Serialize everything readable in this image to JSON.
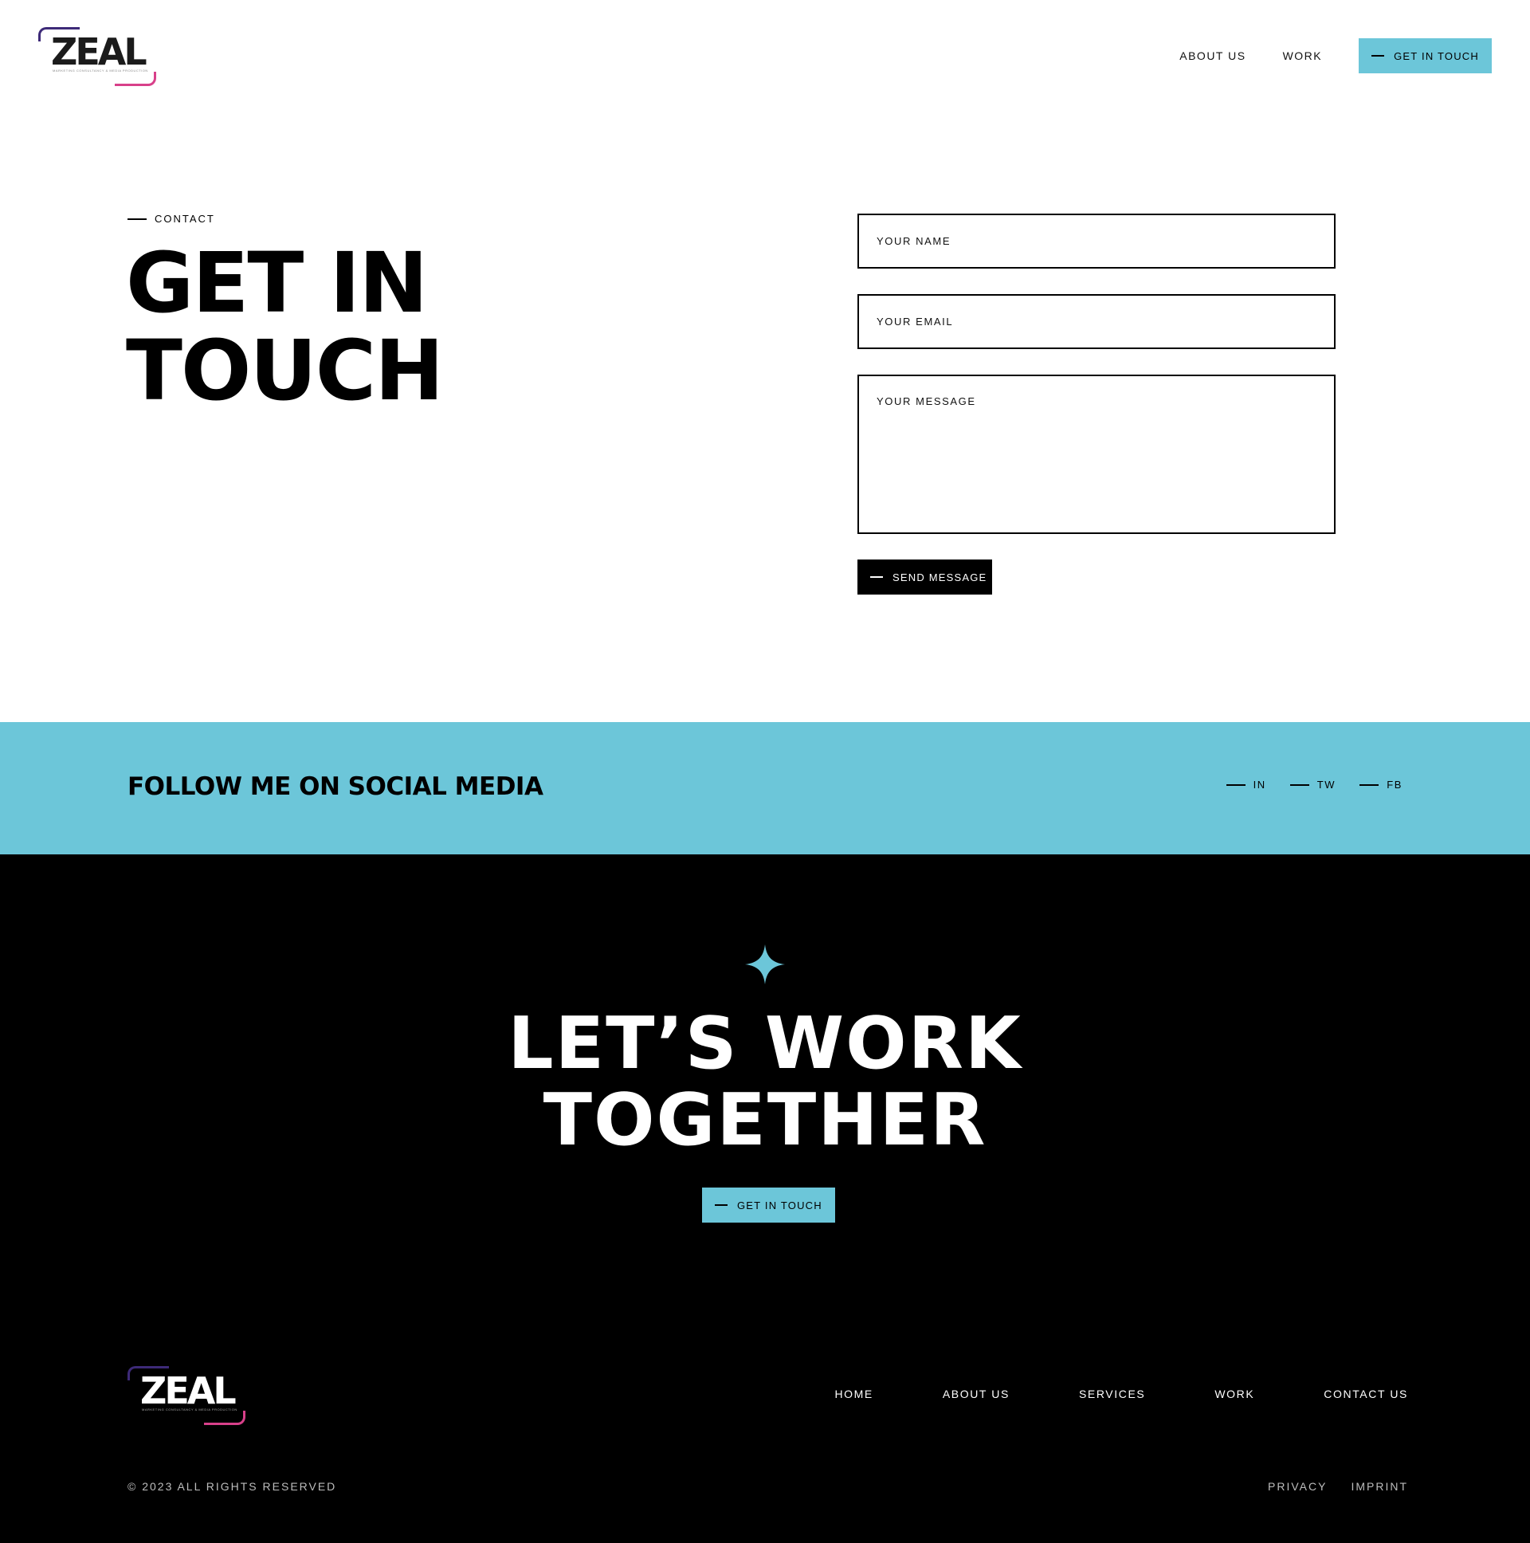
{
  "brand": {
    "name": "ZEAL",
    "tagline": "MARKETING CONSULTANCY & MEDIA PRODUCTION"
  },
  "header": {
    "nav": [
      {
        "label": "ABOUT US"
      },
      {
        "label": "WORK"
      }
    ],
    "cta_label": "GET IN TOUCH"
  },
  "contact": {
    "eyebrow": "CONTACT",
    "title_line1": "GET IN",
    "title_line2": "TOUCH",
    "name_placeholder": "YOUR NAME",
    "email_placeholder": "YOUR EMAIL",
    "message_placeholder": "YOUR MESSAGE",
    "submit_label": "SEND MESSAGE"
  },
  "social": {
    "title": "FOLLOW ME ON SOCIAL MEDIA",
    "links": [
      {
        "label": "IN"
      },
      {
        "label": "TW"
      },
      {
        "label": "FB"
      }
    ]
  },
  "cta": {
    "icon": "sparkle-icon",
    "title_line1": "LET’S WORK",
    "title_line2": "TOGETHER",
    "button_label": "GET IN TOUCH"
  },
  "footer": {
    "nav": [
      {
        "label": "HOME"
      },
      {
        "label": "ABOUT US"
      },
      {
        "label": "SERVICES"
      },
      {
        "label": "WORK"
      },
      {
        "label": "CONTACT US"
      }
    ],
    "copyright": "© 2023 ALL RIGHTS RESERVED",
    "legal": [
      {
        "label": "PRIVACY"
      },
      {
        "label": "IMPRINT"
      }
    ]
  },
  "colors": {
    "accent": "#6cc6d9",
    "dark": "#000000",
    "logo_purple": "#3d2a78",
    "logo_pink": "#d8408a"
  }
}
